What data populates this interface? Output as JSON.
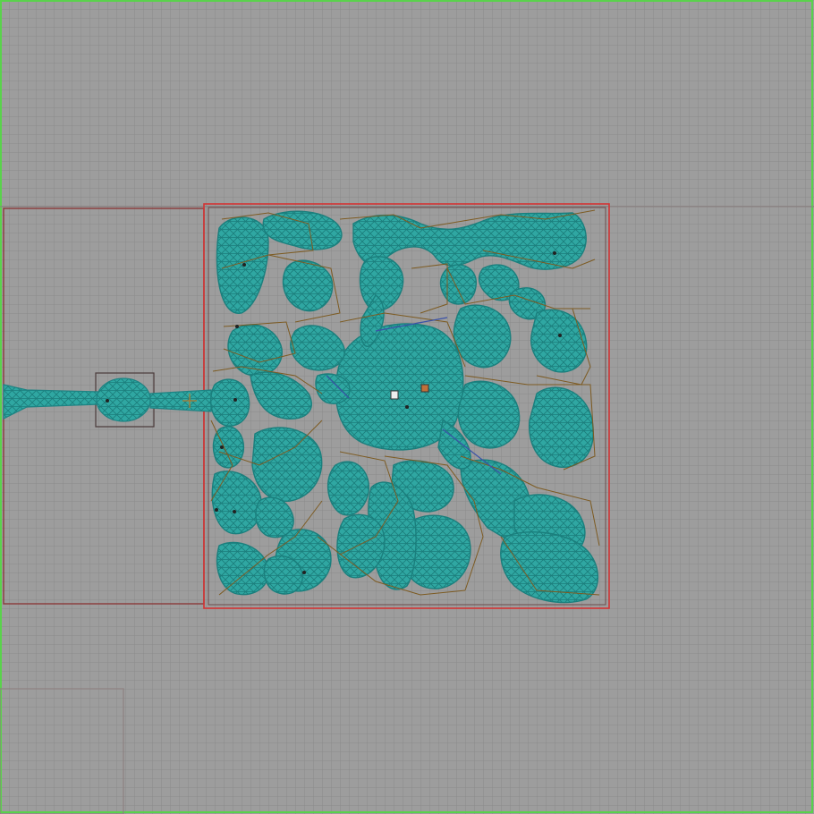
{
  "viewport": {
    "name": "level-editor-top-view",
    "grid_color": "#8c8c8c",
    "background_color": "#9a9a9a",
    "border_color": "#55d24a"
  },
  "colors": {
    "mesh": "#1f8f8f",
    "mesh_fill": "#2a9d9a",
    "region_outline": "#c0392b",
    "sector_outline": "#7a5a1e",
    "room_outline": "#7a4a4a",
    "marker": "#222222",
    "marker_accent": "#c0703a"
  },
  "icons": [
    "entity-marker-icon",
    "light-source-icon",
    "player-start-icon"
  ]
}
